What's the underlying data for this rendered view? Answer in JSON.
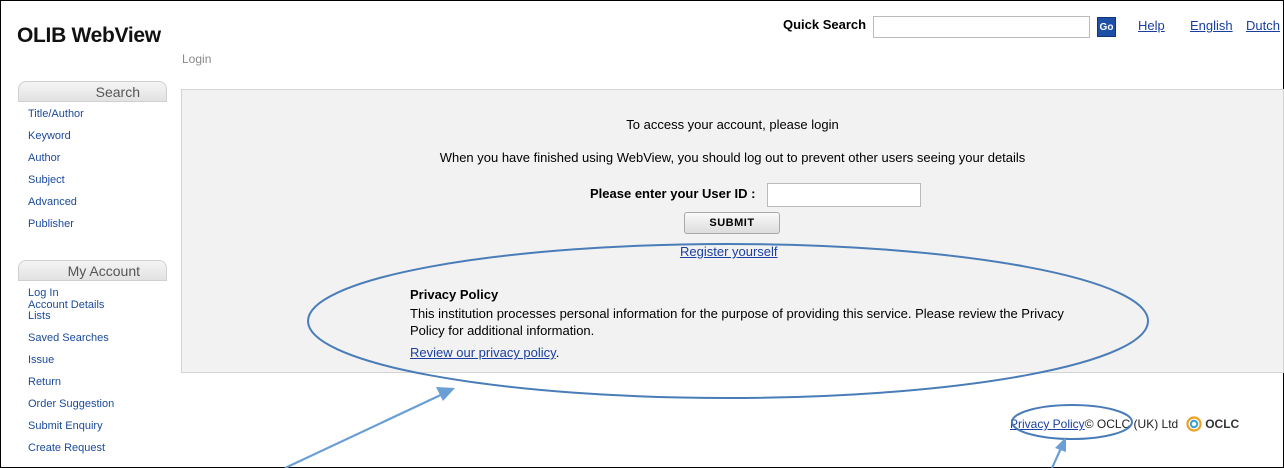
{
  "header": {
    "logo": "OLIB WebView",
    "breadcrumb": "Login",
    "quick_search_label": "Quick Search",
    "quick_search_value": "",
    "go_label": "Go",
    "links": [
      "Help",
      "English",
      "Dutch"
    ]
  },
  "sidebar": {
    "search_title": "Search",
    "search_items": [
      "Title/Author",
      "Keyword",
      "Author",
      "Subject",
      "Advanced",
      "Publisher"
    ],
    "account_title": "My Account",
    "account_login": [
      "Log In",
      "Account Details"
    ],
    "account_items": [
      "Lists",
      "Saved Searches",
      "Issue",
      "Return",
      "Order Suggestion",
      "Submit Enquiry",
      "Create Request"
    ]
  },
  "main": {
    "message1": "To access your account, please login",
    "message2": "When you have finished using WebView, you should log out to prevent other users seeing your details",
    "userid_label": "Please enter your User ID :",
    "userid_value": "",
    "submit_label": "SUBMIT",
    "register_label": "Register yourself",
    "privacy_title": "Privacy Policy",
    "privacy_text": "This institution processes personal information for the purpose of providing this service. Please review the Privacy Policy for additional information.",
    "privacy_link": "Review our privacy policy",
    "privacy_link_suffix": "."
  },
  "footer": {
    "privacy_link": "Privacy Policy",
    "copyright": " © OCLC (UK) Ltd",
    "oclc_logo_text": "OCLC"
  },
  "annotation_color": "#4a7db8"
}
